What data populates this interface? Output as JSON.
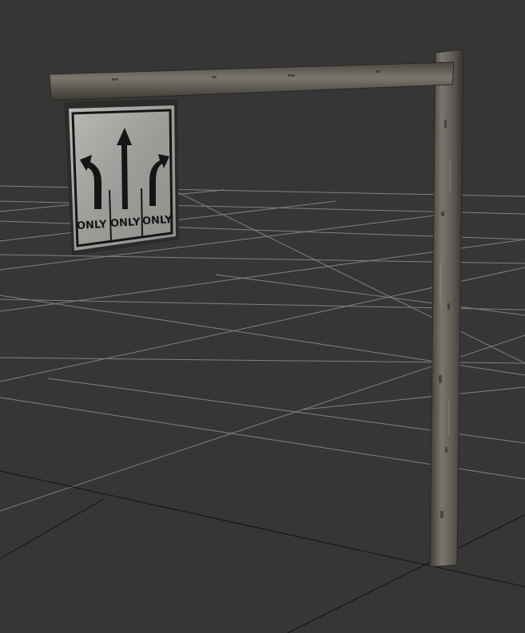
{
  "scene": {
    "description_colors": {
      "background": "#363636",
      "grid_light": "#8a8a8a",
      "grid_dark": "#111111",
      "pole": "#6e6a62",
      "sign_face": "#a9aaa6",
      "sign_ink": "#151515"
    },
    "sign": {
      "lane_labels": [
        "ONLY",
        "ONLY",
        "ONLY"
      ],
      "arrows": [
        "left-turn-arrow",
        "straight-arrow",
        "right-turn-arrow"
      ]
    }
  }
}
